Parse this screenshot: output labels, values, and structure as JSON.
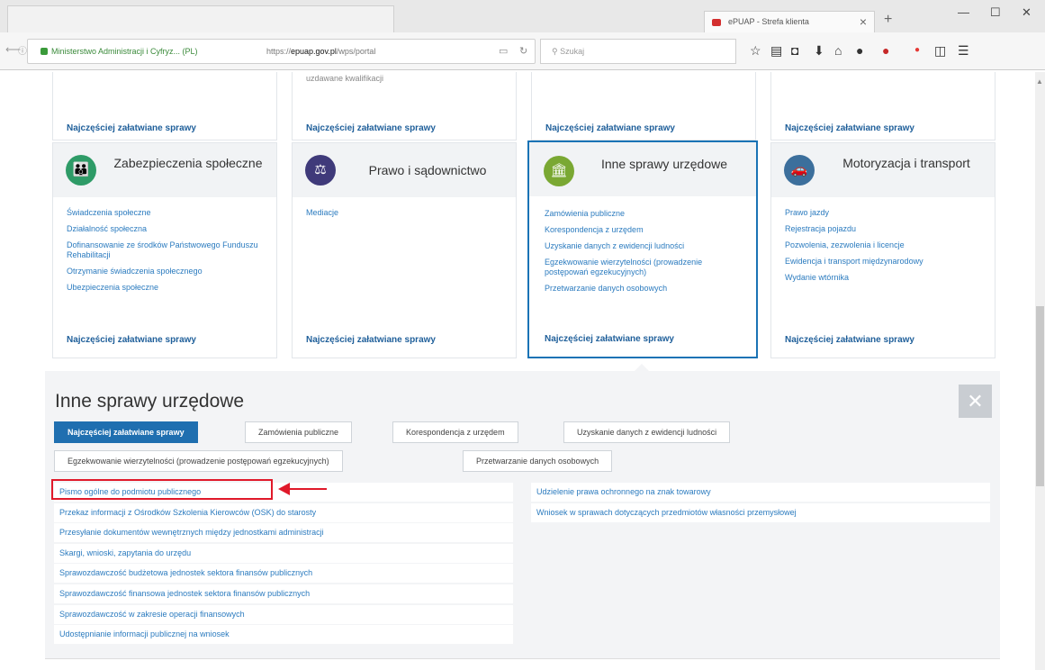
{
  "browser": {
    "tab_title": "ePUAP - Strefa klienta",
    "close_glyph": "×",
    "new_tab_glyph": "+",
    "url_org": "Ministerstwo Administracji i Cyfryz... (PL)",
    "url_prefix": "https://",
    "url_host": "epuap.gov.pl",
    "url_path": "/wps/portal",
    "search_placeholder": "Szukaj",
    "window_controls": [
      "—",
      "☐",
      "✕"
    ],
    "toolbar_icons": [
      "star-icon",
      "library-icon",
      "pocket-icon",
      "download-icon",
      "home-icon",
      "extension-icon",
      "addon-icon",
      "adblock-icon",
      "sidebar-icon",
      "menu-icon"
    ]
  },
  "top_row": {
    "ghost_text": "uzdawane kwalifikacji",
    "most_label": "Najczęściej załatwiane sprawy"
  },
  "cards": [
    {
      "title": "Zabezpieczenia społeczne",
      "icon": "family-icon",
      "color": "#2e9b67",
      "links": [
        "Świadczenia społeczne",
        "Działalność społeczna",
        "Dofinansowanie ze środków Państwowego Funduszu Rehabilitacji",
        "Otrzymanie świadczenia społecznego",
        "Ubezpieczenia społeczne"
      ],
      "most": "Najczęściej załatwiane sprawy"
    },
    {
      "title": "Prawo i sądownictwo",
      "icon": "scales-icon",
      "color": "#3f3a7a",
      "links": [
        "Mediacje"
      ],
      "most": "Najczęściej załatwiane sprawy"
    },
    {
      "title": "Inne sprawy urzędowe",
      "icon": "office-icon",
      "color": "#7aa833",
      "links": [
        "Zamówienia publiczne",
        "Korespondencja z urzędem",
        "Uzyskanie danych z ewidencji ludności",
        "Egzekwowanie wierzytelności (prowadzenie postępowań egzekucyjnych)",
        "Przetwarzanie danych osobowych"
      ],
      "most": "Najczęściej załatwiane sprawy"
    },
    {
      "title": "Motoryzacja i transport",
      "icon": "car-icon",
      "color": "#3c6f9c",
      "links": [
        "Prawo jazdy",
        "Rejestracja pojazdu",
        "Pozwolenia, zezwolenia i licencje",
        "Ewidencja i transport międzynarodowy",
        "Wydanie wtórnika"
      ],
      "most": "Najczęściej załatwiane sprawy"
    }
  ],
  "panel": {
    "title": "Inne sprawy urzędowe",
    "close_glyph": "✕",
    "pills": [
      {
        "label": "Najczęściej załatwiane sprawy",
        "active": true
      },
      {
        "label": "Zamówienia publiczne",
        "active": false
      },
      {
        "label": "Korespondencja z urzędem",
        "active": false
      },
      {
        "label": "Uzyskanie danych z ewidencji ludności",
        "active": false
      },
      {
        "label": "Egzekwowanie wierzytelności (prowadzenie postępowań egzekucyjnych)",
        "active": false
      },
      {
        "label": "Przetwarzanie danych osobowych",
        "active": false
      }
    ],
    "left_items": [
      "Pismo ogólne do podmiotu publicznego",
      "Przekaz informacji z Ośrodków Szkolenia Kierowców (OSK) do starosty",
      "Przesyłanie dokumentów wewnętrznych między jednostkami administracji",
      "Skargi, wnioski, zapytania do urzędu",
      "Sprawozdawczość budżetowa jednostek sektora finansów publicznych",
      "Sprawozdawczość finansowa jednostek sektora finansów publicznych",
      "Sprawozdawczość w zakresie operacji finansowych",
      "Udostępnianie informacji publicznej na wniosek"
    ],
    "right_items": [
      "Udzielenie prawa ochronnego na znak towarowy",
      "Wniosek w sprawach dotyczących przedmiotów własności przemysłowej"
    ]
  }
}
